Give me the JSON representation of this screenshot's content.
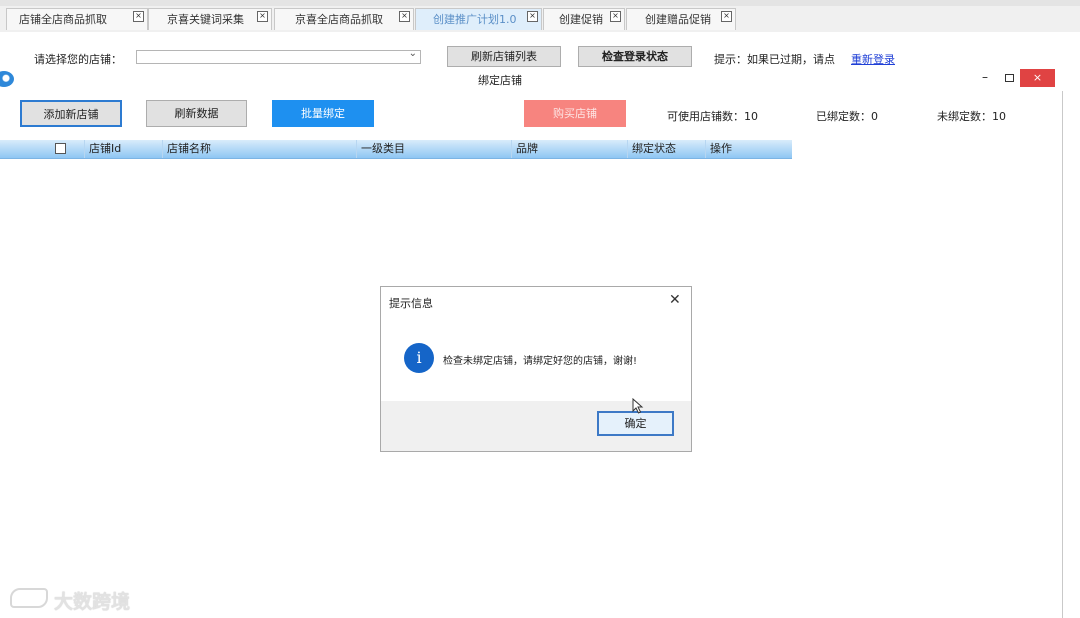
{
  "background_app": {
    "tabs": [
      {
        "label": "店铺全店商品抓取",
        "active": false
      },
      {
        "label": "京喜关键词采集",
        "active": false
      },
      {
        "label": "京喜全店商品抓取",
        "active": false
      },
      {
        "label": "创建推广计划1.0",
        "active": true
      },
      {
        "label": "创建促销",
        "active": false
      },
      {
        "label": "创建赠品促销",
        "active": false
      }
    ],
    "tab_close_glyph": "×",
    "shop_select_label": "请选择您的店铺：",
    "shop_select_value": "",
    "refresh_shop_list": "刷新店铺列表",
    "check_login": "检查登录状态",
    "hint": "提示：如果已过期，请点",
    "relogin_link": "重新登录"
  },
  "bind_window": {
    "title": "绑定店铺",
    "buttons": {
      "add_shop": "添加新店铺",
      "refresh_data": "刷新数据",
      "batch_bind": "批量绑定",
      "buy_shop": "购买店铺"
    },
    "stats": {
      "available_label": "可使用店铺数：",
      "available_value": "10",
      "bound_label": "已绑定数：",
      "bound_value": "0",
      "unbound_label": "未绑定数：",
      "unbound_value": "10"
    },
    "table_headers": [
      "店铺Id",
      "店铺名称",
      "一级类目",
      "品牌",
      "绑定状态",
      "操作"
    ],
    "close_glyph": "×",
    "minimize_glyph": "–"
  },
  "message_box": {
    "title": "提示信息",
    "icon": "info-icon",
    "icon_glyph": "i",
    "message": "检查未绑定店铺，请绑定好您的店铺，谢谢!",
    "ok": "确定",
    "close_glyph": "✕"
  },
  "watermark": {
    "text": "大数跨境"
  },
  "colors": {
    "batch_button": "#1e90f0",
    "buy_button": "#f7847f",
    "window_close": "#e04343",
    "info_icon": "#1565c8",
    "link": "#1f3fd6"
  }
}
